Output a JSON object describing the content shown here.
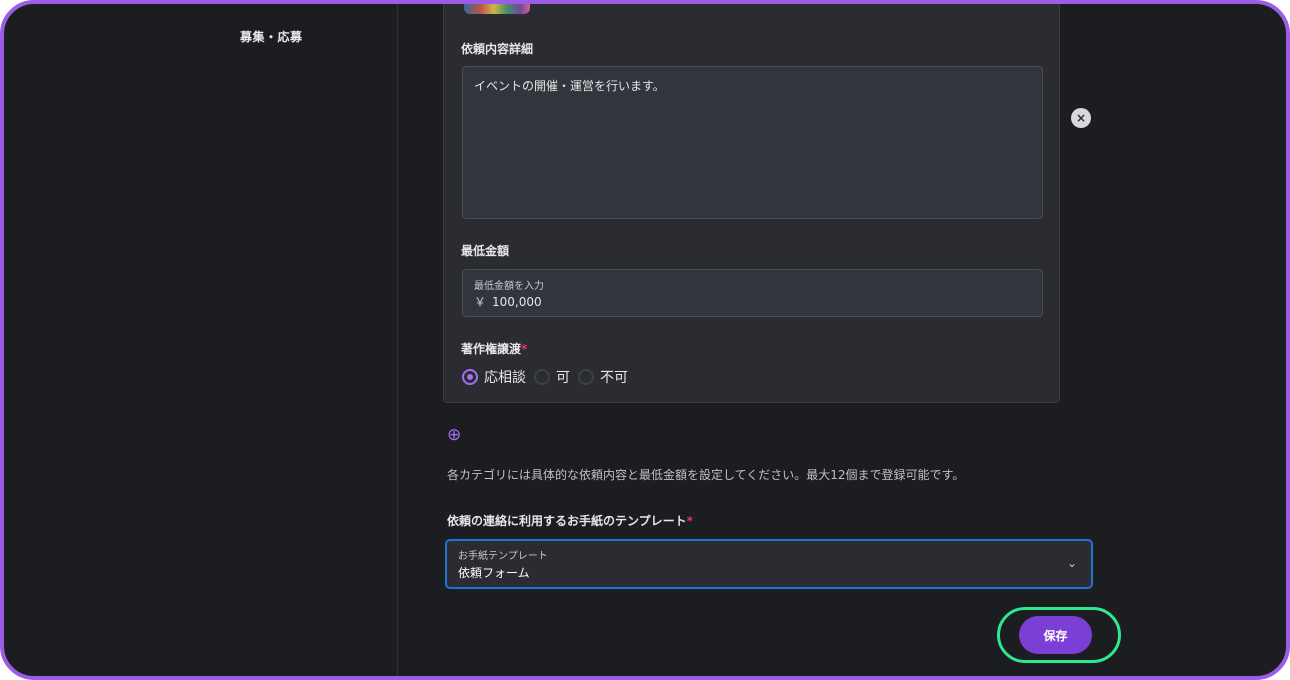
{
  "sidebar": {
    "heading": "募集・応募"
  },
  "category_card": {
    "detail_label": "依頼内容詳細",
    "detail_value": "イベントの開催・運営を行います。",
    "min_amount_label": "最低金額",
    "min_amount_placeholder": "最低金額を入力",
    "currency_symbol": "￥",
    "min_amount_value": "100,000",
    "copyright_label": "著作権譲渡",
    "required_mark": "*",
    "copyright_options": [
      {
        "label": "応相談",
        "checked": true
      },
      {
        "label": "可",
        "checked": false
      },
      {
        "label": "不可",
        "checked": false
      }
    ],
    "remove_icon": "close-circle-icon"
  },
  "add_icon": "plus-circle-icon",
  "help_text": "各カテゴリには具体的な依頼内容と最低金額を設定してください。最大12個まで登録可能です。",
  "template": {
    "label": "依頼の連絡に利用するお手紙のテンプレート",
    "required_mark": "*",
    "caption": "お手紙テンプレート",
    "value": "依頼フォーム"
  },
  "save_label": "保存",
  "colors": {
    "accent": "#7b3fd6",
    "focus": "#1f73d8",
    "highlight": "#2ee88f",
    "required": "#e0356b"
  }
}
